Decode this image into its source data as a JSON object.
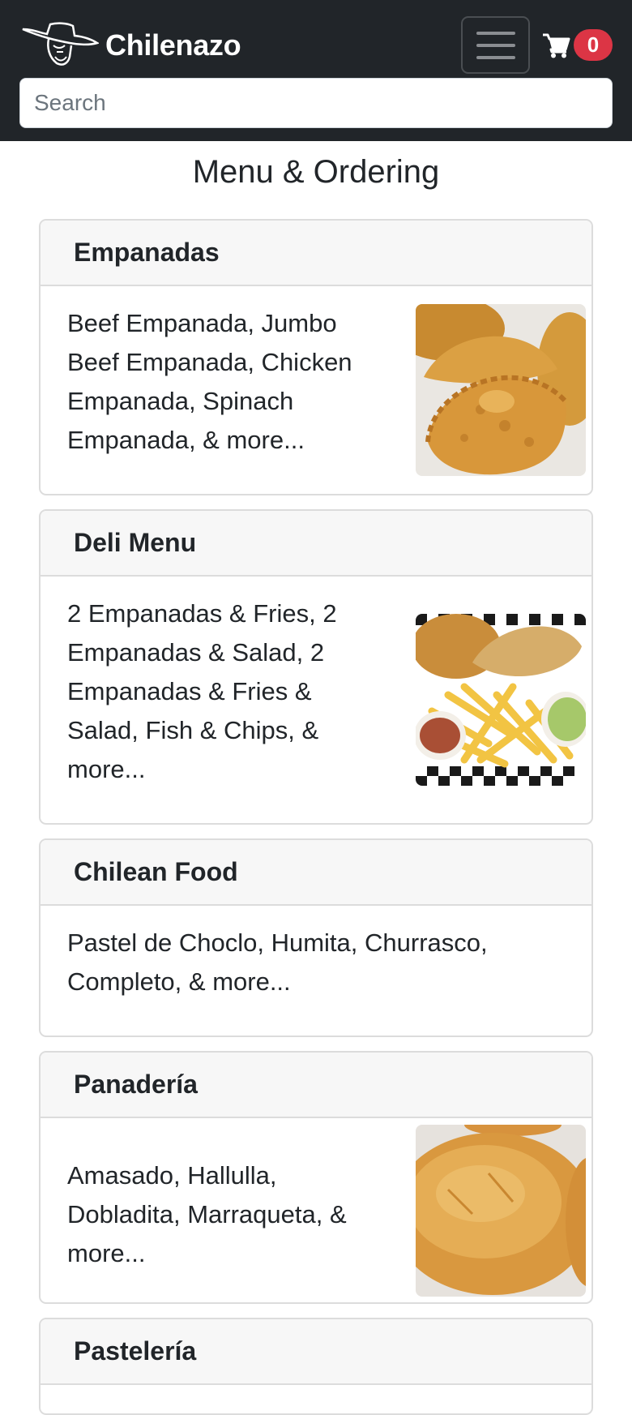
{
  "navbar": {
    "brand": "Chilenazo",
    "logo_icon": "cowboy-hat-logo-icon",
    "menu_icon": "hamburger-icon",
    "cart_icon": "shopping-cart-icon",
    "cart_count": "0",
    "search_placeholder": "Search"
  },
  "page": {
    "title": "Menu & Ordering"
  },
  "categories": [
    {
      "name": "Empanadas",
      "description": "Beef Empanada, Jumbo Beef Empanada, Chicken Empanada, Spinach Empanada, & more..."
    },
    {
      "name": "Deli Menu",
      "description": "2 Empanadas & Fries, 2 Empanadas & Salad, 2 Empanadas & Fries & Salad, Fish & Chips, & more..."
    },
    {
      "name": "Chilean Food",
      "description": "Pastel de Choclo, Humita, Churrasco, Completo, & more..."
    },
    {
      "name": "Panadería",
      "description": "Amasado, Hallulla, Dobladita, Marraqueta, & more..."
    },
    {
      "name": "Pastelería",
      "description": ""
    }
  ],
  "colors": {
    "navbar_bg": "#212529",
    "badge_bg": "#dc3545",
    "card_header_bg": "#f7f7f7"
  }
}
